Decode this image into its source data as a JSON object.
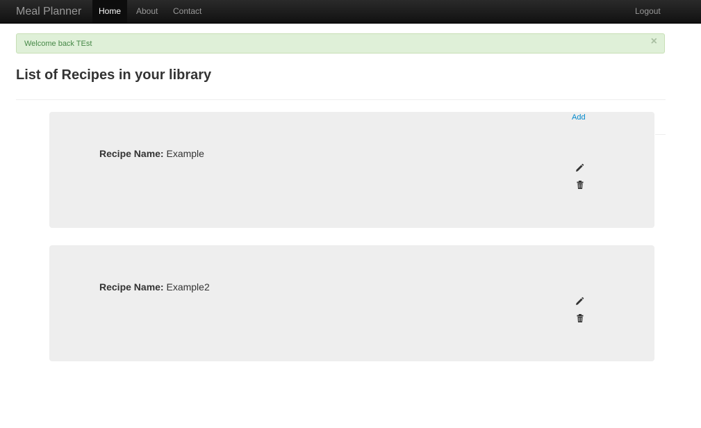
{
  "navbar": {
    "brand": "Meal Planner",
    "links": [
      {
        "label": "Home",
        "active": true
      },
      {
        "label": "About"
      },
      {
        "label": "Contact"
      }
    ],
    "logout_label": "Logout"
  },
  "alert": {
    "message": "Welcome back TEst",
    "close_symbol": "×"
  },
  "page": {
    "title": "List of Recipes in your library",
    "add_label": "Add"
  },
  "recipes": [
    {
      "label": "Recipe Name:",
      "name": "Example",
      "edit_icon": "pencil-icon",
      "delete_icon": "trash-icon"
    },
    {
      "label": "Recipe Name:",
      "name": "Example2",
      "edit_icon": "pencil-icon",
      "delete_icon": "trash-icon"
    }
  ],
  "colors": {
    "navbar": "#1b1b1b",
    "alert_bg": "#dff0d8",
    "alert_text": "#468847",
    "link": "#0088cc",
    "card_bg": "#eeeeee"
  }
}
